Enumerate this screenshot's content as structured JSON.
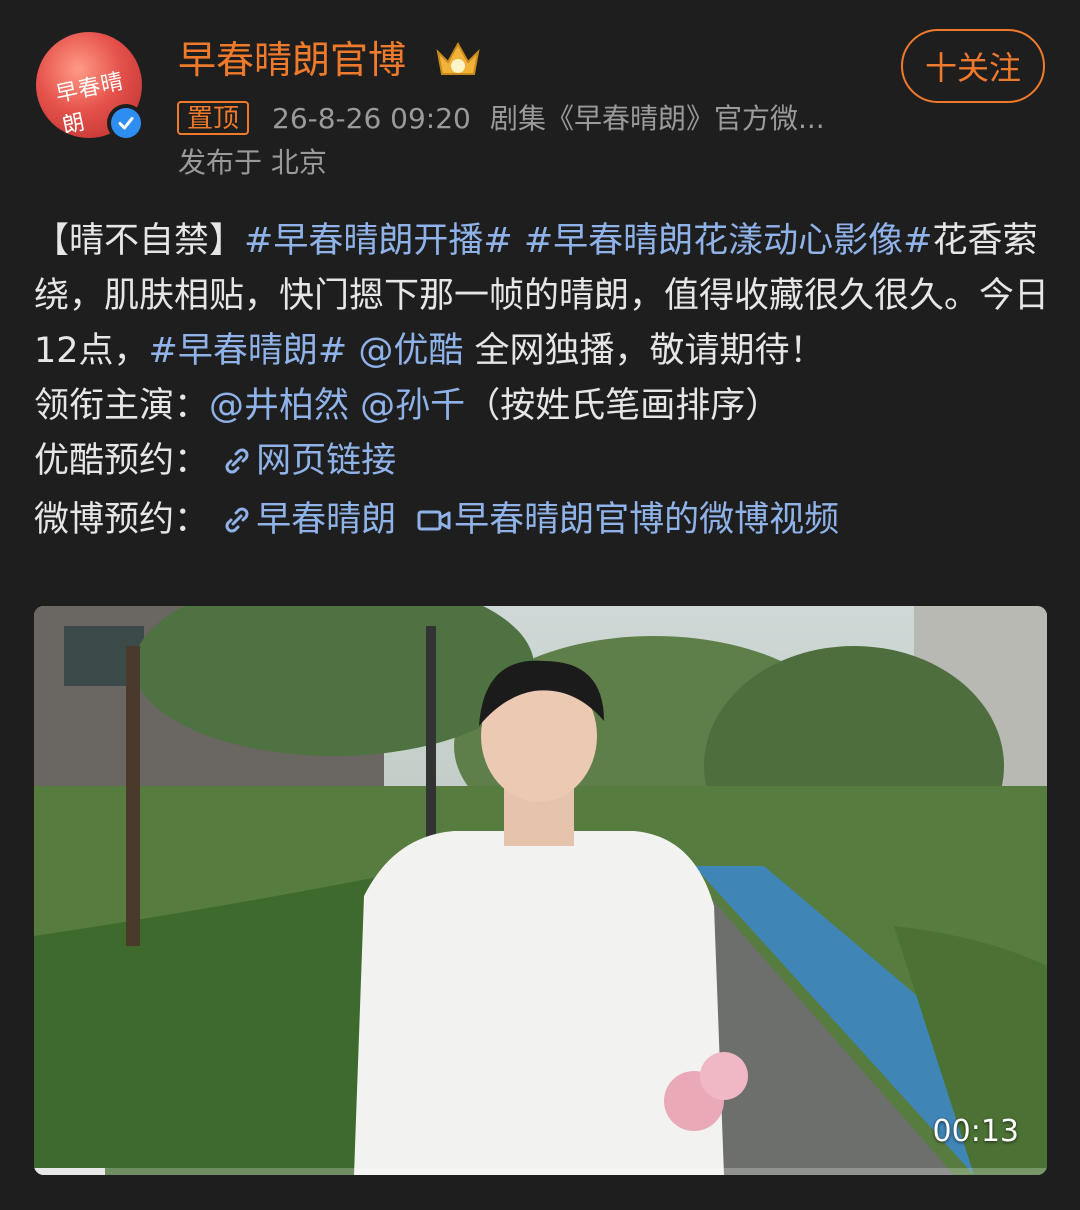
{
  "account": {
    "name": "早春晴朗官博",
    "avatar_text": "早春晴朗",
    "follow_label": "十关注"
  },
  "meta": {
    "pin_label": "置顶",
    "timestamp": "26-8-26 09:20",
    "source": "剧集《早春晴朗》官方微...",
    "location": "发布于 北京"
  },
  "post": {
    "p1_prefix": "【晴不自禁】",
    "tag1": "#早春晴朗开播#",
    "tag2": "#早春晴朗花漾动心影像#",
    "p1_text": "花香萦绕，肌肤相贴，快门摁下那一帧的晴朗，值得收藏很久很久。今日12点，",
    "tag3": "#早春晴朗#",
    "mention_youku": "@优酷",
    "p1_suffix": " 全网独播，敬请期待！",
    "cast_label": "领衔主演：",
    "cast1": "@井柏然",
    "cast2": "@孙千",
    "cast_note": "（按姓氏笔画排序）",
    "youku_label": "优酷预约：",
    "youku_link": "网页链接",
    "weibo_label": "微博预约：",
    "weibo_link": "早春晴朗",
    "video_link": "早春晴朗官博的微博视频"
  },
  "video": {
    "duration": "00:13",
    "progress_fraction": 0.07
  },
  "colors": {
    "accent": "#f07a2b",
    "link": "#8fb2e8",
    "background": "#1e1e1e"
  }
}
